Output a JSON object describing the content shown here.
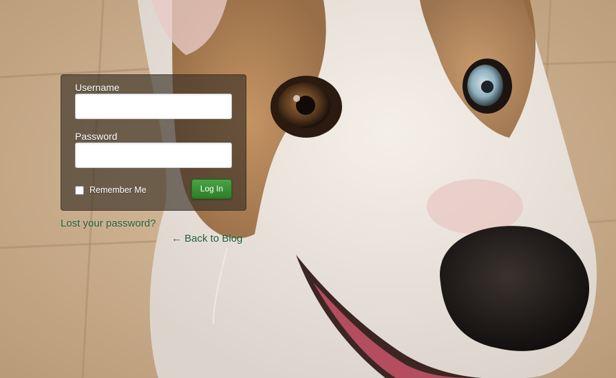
{
  "login_form": {
    "username_label": "Username",
    "username_value": "",
    "password_label": "Password",
    "password_value": "",
    "remember_label": "Remember Me",
    "remember_checked": false,
    "submit_label": "Log In",
    "submit_color": "#3a9434"
  },
  "links": {
    "lost_password": "Lost your password?",
    "back_to_blog": "← Back to Blog",
    "link_color": "#1f5e3a"
  },
  "background": {
    "subject": "corgi dog face on tiled floor",
    "floor_color": "#c9ab8b"
  }
}
